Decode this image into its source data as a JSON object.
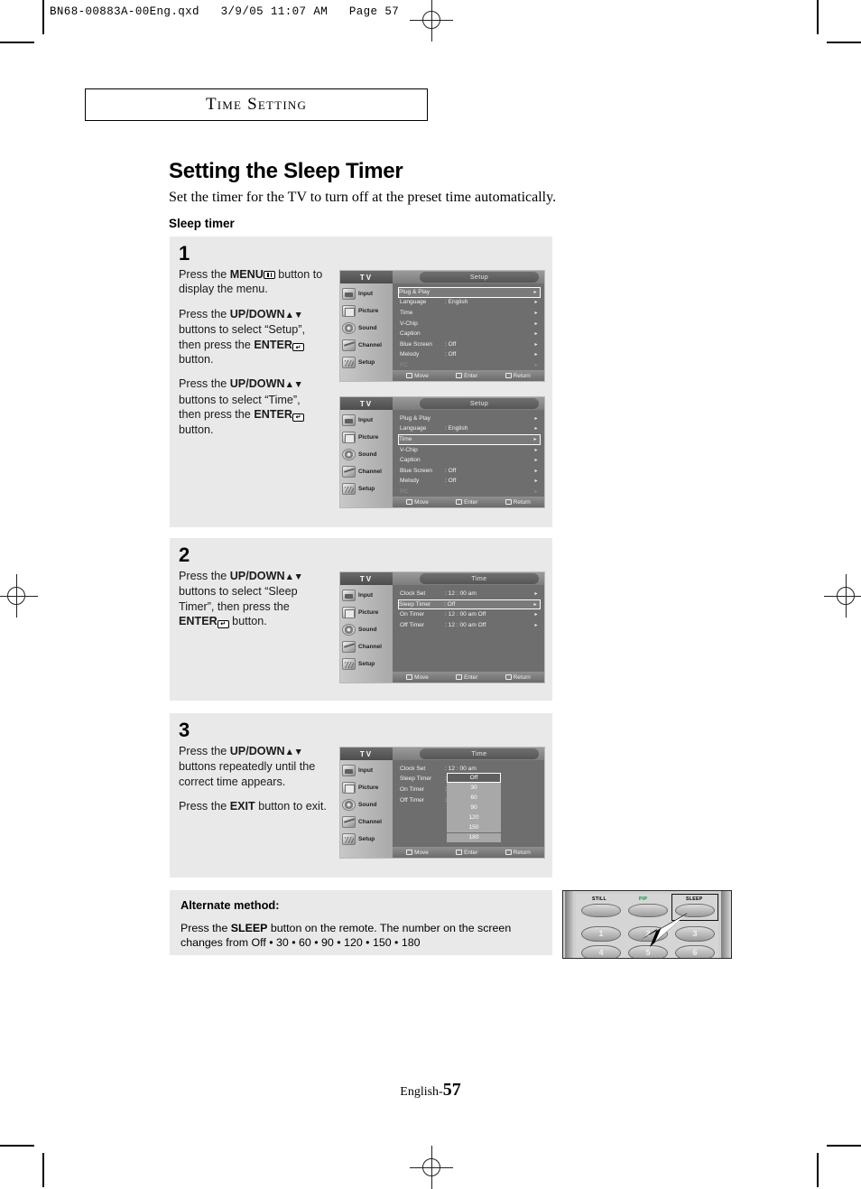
{
  "file_header": "BN68-00883A-00Eng.qxd   3/9/05 11:07 AM   Page 57",
  "section_title": "Time Setting",
  "heading": "Setting the Sleep Timer",
  "subheading": "Set the timer for the TV to turn off at the preset time automatically.",
  "section_label": "Sleep timer",
  "steps": [
    {
      "number": "1",
      "paragraphs": [
        {
          "parts": [
            {
              "t": "text",
              "v": "Press the "
            },
            {
              "t": "bold",
              "v": "MENU"
            },
            {
              "t": "icon",
              "v": "menu-icon"
            },
            {
              "t": "text",
              "v": " button to display the menu."
            }
          ]
        },
        {
          "parts": [
            {
              "t": "text",
              "v": "Press the "
            },
            {
              "t": "bold",
              "v": "UP/DOWN"
            },
            {
              "t": "icon",
              "v": "up-down-arrows-icon"
            },
            {
              "t": "text",
              "v": " buttons to select “Setup”, then press the "
            },
            {
              "t": "bold",
              "v": "ENTER"
            },
            {
              "t": "icon",
              "v": "enter-icon"
            },
            {
              "t": "text",
              "v": " button."
            }
          ]
        },
        {
          "parts": [
            {
              "t": "text",
              "v": "Press the "
            },
            {
              "t": "bold",
              "v": "UP/DOWN"
            },
            {
              "t": "icon",
              "v": "up-down-arrows-icon"
            },
            {
              "t": "text",
              "v": " buttons to select “Time”, then press the "
            },
            {
              "t": "bold",
              "v": "ENTER"
            },
            {
              "t": "icon",
              "v": "enter-icon"
            },
            {
              "t": "text",
              "v": " button."
            }
          ]
        }
      ]
    },
    {
      "number": "2",
      "paragraphs": [
        {
          "parts": [
            {
              "t": "text",
              "v": "Press the "
            },
            {
              "t": "bold",
              "v": "UP/DOWN"
            },
            {
              "t": "icon",
              "v": "up-down-arrows-icon"
            },
            {
              "t": "text",
              "v": " buttons to select “Sleep Timer”, then press the "
            },
            {
              "t": "bold",
              "v": "ENTER"
            },
            {
              "t": "icon",
              "v": "enter-icon"
            },
            {
              "t": "text",
              "v": " button."
            }
          ]
        }
      ]
    },
    {
      "number": "3",
      "paragraphs": [
        {
          "parts": [
            {
              "t": "text",
              "v": "Press the "
            },
            {
              "t": "bold",
              "v": "UP/DOWN"
            },
            {
              "t": "icon",
              "v": "up-down-arrows-icon"
            },
            {
              "t": "text",
              "v": " buttons repeatedly until the correct time appears."
            }
          ]
        },
        {
          "parts": [
            {
              "t": "text",
              "v": "Press the "
            },
            {
              "t": "bold",
              "v": "EXIT"
            },
            {
              "t": "text",
              "v": " button to exit."
            }
          ]
        }
      ]
    }
  ],
  "osd_common": {
    "tv_label": "TV",
    "sidebar": [
      {
        "label": "Input",
        "icon": "input-icon"
      },
      {
        "label": "Picture",
        "icon": "picture-icon"
      },
      {
        "label": "Sound",
        "icon": "sound-icon"
      },
      {
        "label": "Channel",
        "icon": "channel-icon"
      },
      {
        "label": "Setup",
        "icon": "setup-icon"
      }
    ],
    "bottom_bar": [
      {
        "label": "Move",
        "icon": "move-updown-icon"
      },
      {
        "label": "Enter",
        "icon": "enter-icon"
      },
      {
        "label": "Return",
        "icon": "return-icon"
      }
    ]
  },
  "osd_screens": [
    {
      "id": "setup-plugplay",
      "title": "Setup",
      "rows": [
        {
          "name": "Plug & Play",
          "value": "",
          "selected": true,
          "dim": false,
          "arrow": "▸"
        },
        {
          "name": "Language",
          "value": ": English",
          "selected": false,
          "dim": false,
          "arrow": "▸"
        },
        {
          "name": "Time",
          "value": "",
          "selected": false,
          "dim": false,
          "arrow": "▸"
        },
        {
          "name": "V-Chip",
          "value": "",
          "selected": false,
          "dim": false,
          "arrow": "▸"
        },
        {
          "name": "Caption",
          "value": "",
          "selected": false,
          "dim": false,
          "arrow": "▸"
        },
        {
          "name": "Blue Screen",
          "value": ": Off",
          "selected": false,
          "dim": false,
          "arrow": "▸"
        },
        {
          "name": "Melody",
          "value": ": Off",
          "selected": false,
          "dim": false,
          "arrow": "▸"
        },
        {
          "name": "PC",
          "value": "",
          "selected": false,
          "dim": true,
          "arrow": "▸"
        }
      ]
    },
    {
      "id": "setup-time",
      "title": "Setup",
      "rows": [
        {
          "name": "Plug & Play",
          "value": "",
          "selected": false,
          "dim": false,
          "arrow": "▸"
        },
        {
          "name": "Language",
          "value": ": English",
          "selected": false,
          "dim": false,
          "arrow": "▸"
        },
        {
          "name": "Time",
          "value": "",
          "selected": true,
          "dim": false,
          "arrow": "▸"
        },
        {
          "name": "V-Chip",
          "value": "",
          "selected": false,
          "dim": false,
          "arrow": "▸"
        },
        {
          "name": "Caption",
          "value": "",
          "selected": false,
          "dim": false,
          "arrow": "▸"
        },
        {
          "name": "Blue Screen",
          "value": ": Off",
          "selected": false,
          "dim": false,
          "arrow": "▸"
        },
        {
          "name": "Melody",
          "value": ": Off",
          "selected": false,
          "dim": false,
          "arrow": "▸"
        },
        {
          "name": "PC",
          "value": "",
          "selected": false,
          "dim": true,
          "arrow": "▸"
        }
      ]
    },
    {
      "id": "time-sleeptimer",
      "title": "Time",
      "rows": [
        {
          "name": "Clock Set",
          "value": ": 12 : 00  am",
          "selected": false,
          "dim": false,
          "arrow": "▸"
        },
        {
          "name": "Sleep Timer",
          "value": ":          Off",
          "selected": true,
          "dim": false,
          "arrow": "▸"
        },
        {
          "name": "On Timer",
          "value": ": 12 : 00  am Off",
          "selected": false,
          "dim": false,
          "arrow": "▸"
        },
        {
          "name": "Off Timer",
          "value": ": 12 : 00  am Off",
          "selected": false,
          "dim": false,
          "arrow": "▸"
        }
      ]
    },
    {
      "id": "time-sleeptimer-options",
      "title": "Time",
      "rows": [
        {
          "name": "Clock Set",
          "value": ": 12 : 00  am",
          "selected": false,
          "dim": false,
          "arrow": ""
        },
        {
          "name": "Sleep Timer",
          "value": ":",
          "selected": false,
          "dim": false,
          "arrow": ""
        },
        {
          "name": "On Timer",
          "value": ":",
          "selected": false,
          "dim": false,
          "arrow": ""
        },
        {
          "name": "Off Timer",
          "value": ":",
          "selected": false,
          "dim": false,
          "arrow": ""
        }
      ],
      "options": [
        "Off",
        "30",
        "60",
        "90",
        "120",
        "150",
        "180"
      ],
      "selected_option": "Off"
    }
  ],
  "alternate": {
    "title": "Alternate method:",
    "parts": [
      {
        "t": "text",
        "v": "Press the "
      },
      {
        "t": "bold",
        "v": "SLEEP"
      },
      {
        "t": "text",
        "v": " button on the remote. The number on the screen changes from Off • 30 • 60 • 90 • 120 • 150 • 180"
      }
    ]
  },
  "remote": {
    "top_buttons": [
      {
        "label": "STILL",
        "color": "#1a1a1a",
        "highlighted": false
      },
      {
        "label": "PIP",
        "color": "#00953f",
        "highlighted": false
      },
      {
        "label": "SLEEP",
        "color": "#1a1a1a",
        "highlighted": true
      }
    ],
    "number_rows": [
      [
        "1",
        "2",
        "3"
      ],
      [
        "4",
        "5",
        "6"
      ]
    ]
  },
  "footer": {
    "language": "English-",
    "page": "57"
  }
}
